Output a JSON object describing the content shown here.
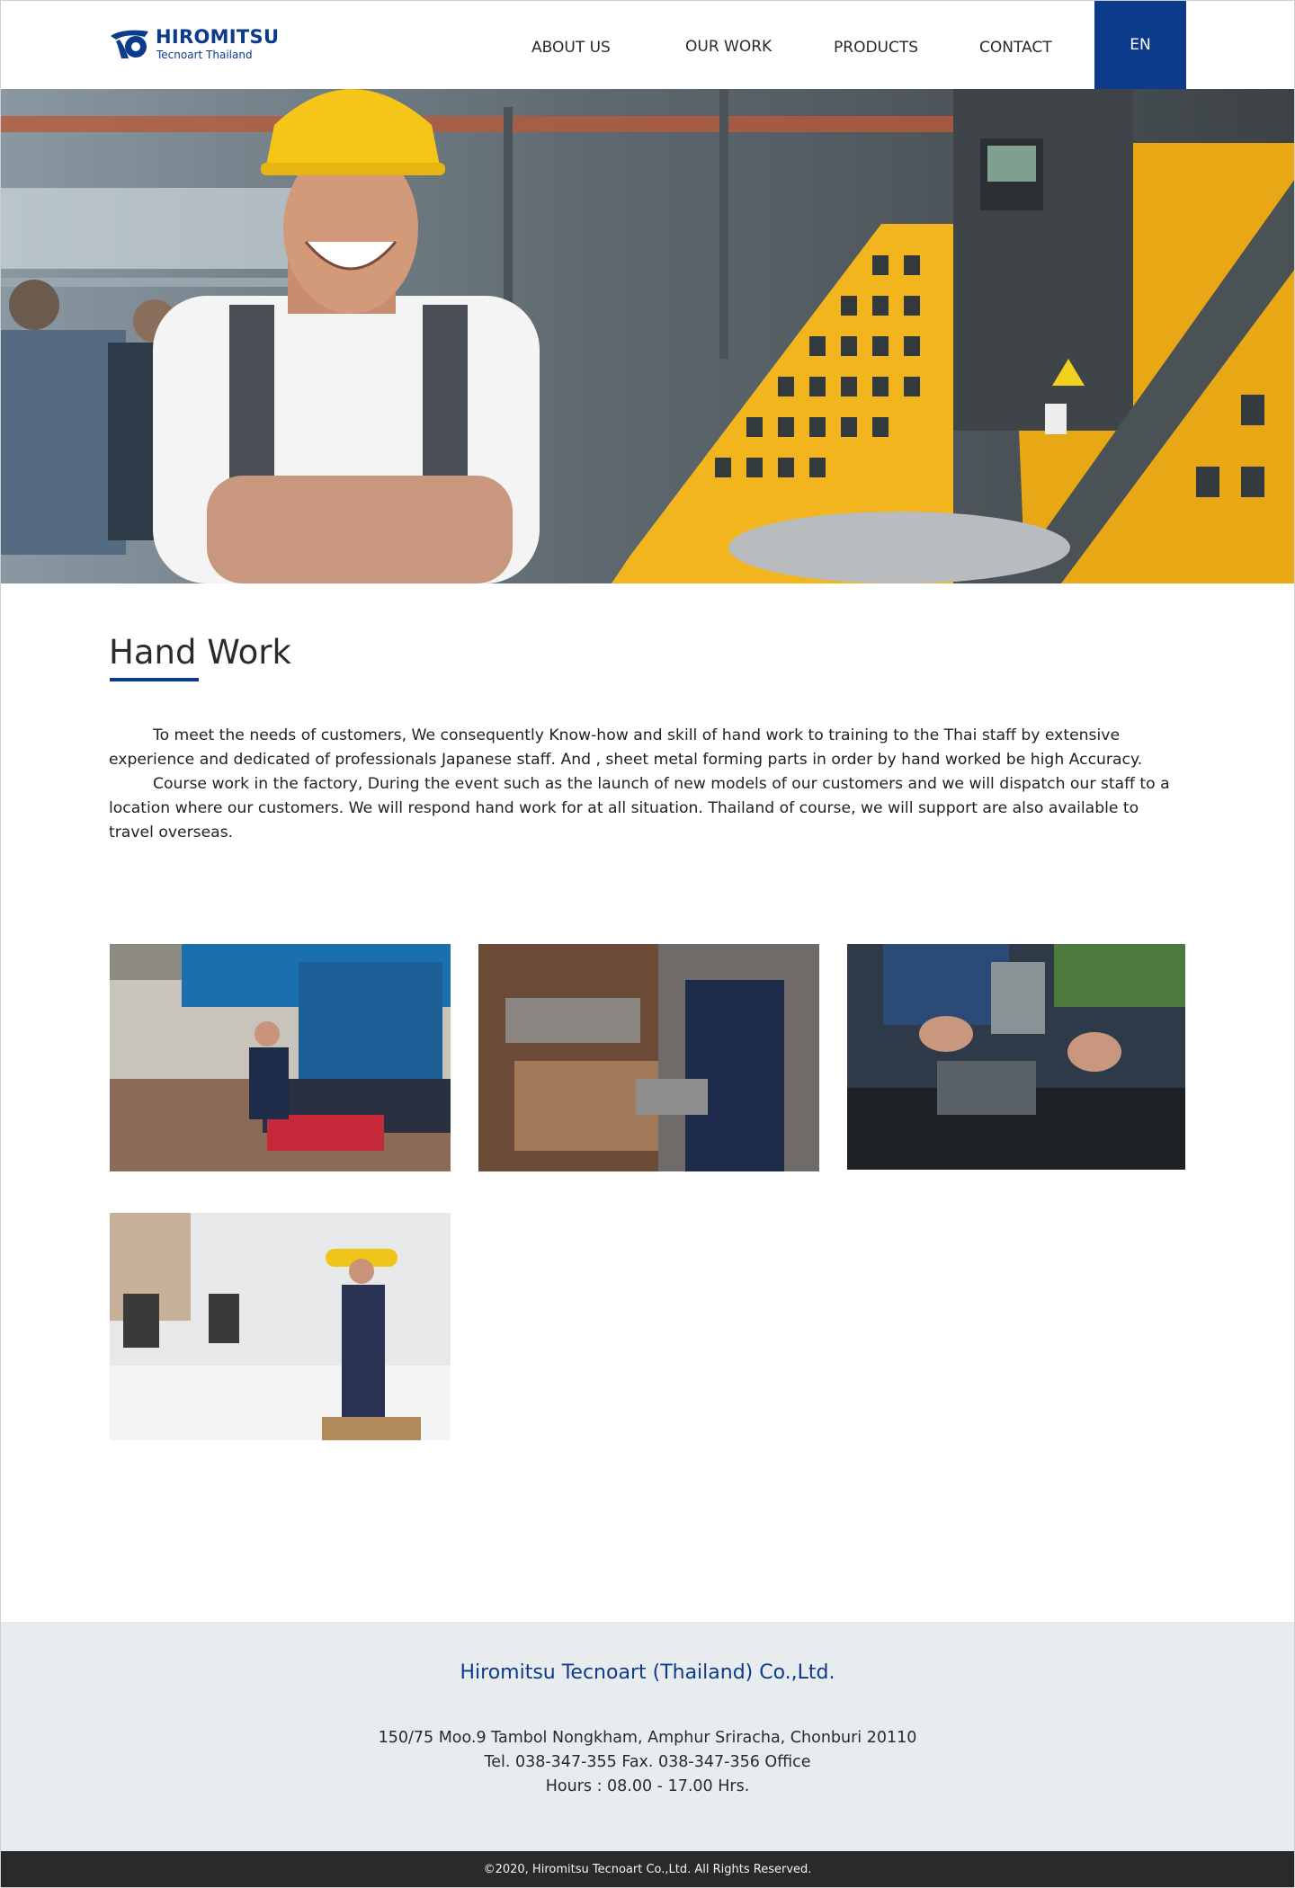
{
  "header": {
    "logo": {
      "name": "HIROMITSU",
      "sub": "Tecnoart Thailand"
    },
    "nav": {
      "about": "ABOUT US",
      "work": "OUR WORK",
      "products": "PRODUCTS",
      "contact": "CONTACT",
      "lang": "EN"
    }
  },
  "main": {
    "title": "Hand Work",
    "paragraphs": [
      "To meet the needs of customers, We consequently Know-how and skill of hand work to training to the Thai staff by extensive experience and dedicated of professionals Japanese staff. And , sheet metal forming parts in order by hand worked be high Accuracy.",
      "Course work in the factory, During the event such as the launch of new models of our customers and we will dispatch our staff to a location where our customers. We will respond hand work for at all situation. Thailand of course, we will support are also available to travel overseas."
    ]
  },
  "footer": {
    "company": "Hiromitsu Tecnoart (Thailand) Co.,Ltd.",
    "address": "150/75 Moo.9 Tambol Nongkham, Amphur Sriracha, Chonburi 20110",
    "phone": "Tel. 038-347-355  Fax. 038-347-356 Office",
    "hours": "Hours : 08.00 - 17.00 Hrs.",
    "copyright": "©2020, Hiromitsu Tecnoart Co.,Ltd. All Rights Reserved."
  },
  "colors": {
    "brand": "#0d3b8c",
    "footer_bg": "#e8ecef",
    "copyright_bg": "#2a2a2a"
  }
}
